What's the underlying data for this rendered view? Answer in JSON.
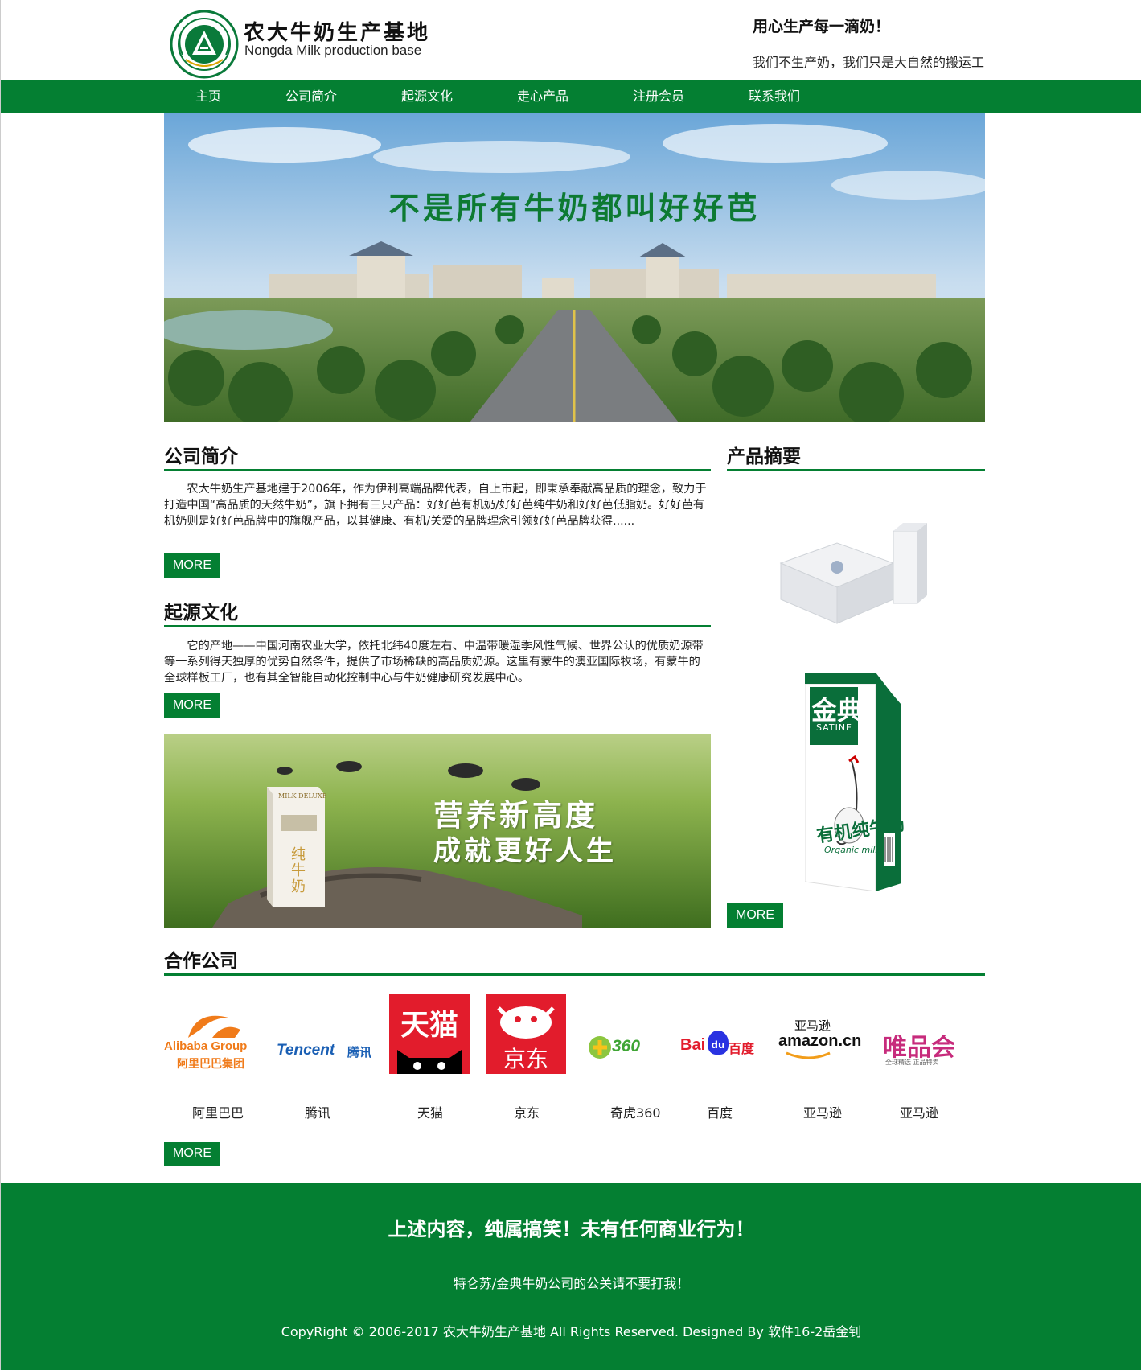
{
  "header": {
    "brand_cn": "农大牛奶生产基地",
    "brand_en": "Nongda Milk production base",
    "slogan_main": "用心生产每一滴奶！",
    "slogan_sub": "我们不生产奶，我们只是大自然的搬运工",
    "logo_icon": "university-emblem-icon"
  },
  "nav": {
    "items": [
      {
        "label": "主页"
      },
      {
        "label": "公司简介"
      },
      {
        "label": "起源文化"
      },
      {
        "label": "走心产品"
      },
      {
        "label": "注册会员"
      },
      {
        "label": "联系我们"
      }
    ]
  },
  "banner": {
    "headline": "不是所有牛奶都叫好好芭"
  },
  "company_intro": {
    "title": "公司简介",
    "text": "农大牛奶生产基地建于2006年，作为伊利高端品牌代表，自上市起，即秉承奉献高品质的理念，致力于打造中国“高品质的天然牛奶”，旗下拥有三只产品：好好芭有机奶/好好芭纯牛奶和好好芭低脂奶。好好芭有机奶则是好好芭品牌中的旗舰产品，以其健康、有机/关爱的品牌理念引领好好芭品牌获得......",
    "more": "MORE"
  },
  "origin_culture": {
    "title": "起源文化",
    "text": "它的产地——中国河南农业大学，依托北纬40度左右、中温带暖湿季风性气候、世界公认的优质奶源带等一系列得天独厚的优势自然条件，提供了市场稀缺的高品质奶源。这里有蒙牛的澳亚国际牧场，有蒙牛的全球样板工厂，也有其全智能自动化控制中心与牛奶健康研究发展中心。",
    "more": "MORE"
  },
  "promo": {
    "line1": "营养新高度",
    "line2": "成就更好人生",
    "carton_label": "纯牛奶",
    "carton_brand": "MILK DELUXE"
  },
  "product_summary": {
    "title": "产品摘要",
    "carton_brand": "金典",
    "carton_brand_en": "SATINE",
    "carton_product": "有机纯牛奶",
    "carton_en": "Organic milk",
    "more": "MORE"
  },
  "partners": {
    "title": "合作公司",
    "items": [
      {
        "name": "阿里巴巴",
        "logo_text": "Alibaba Group",
        "logo_sub": "阿里巴巴集团"
      },
      {
        "name": "腾讯",
        "logo_text": "Tencent",
        "logo_sub": "腾讯"
      },
      {
        "name": "天猫",
        "logo_text": "天猫"
      },
      {
        "name": "京东",
        "logo_text": "京东"
      },
      {
        "name": "奇虎360",
        "logo_text": "360"
      },
      {
        "name": "百度",
        "logo_text": "Bai",
        "logo_mid": "du",
        "logo_sub": "百度"
      },
      {
        "name": "亚马逊",
        "logo_text": "amazon.cn",
        "logo_sub": "亚马逊"
      },
      {
        "name": "亚马逊",
        "logo_text": "唯品会",
        "logo_sub": "全球精选 正品特卖"
      }
    ],
    "more": "MORE"
  },
  "footer": {
    "line1": "上述内容，纯属搞笑！未有任何商业行为！",
    "line2": "特仑苏/金典牛奶公司的公关请不要打我！",
    "copyright": "CopyRight © 2006-2017 农大牛奶生产基地 All Rights Reserved. Designed By 软件16-2岳金钊"
  },
  "colors": {
    "brand_green": "#047f32",
    "headline_green": "#0d7a32"
  }
}
